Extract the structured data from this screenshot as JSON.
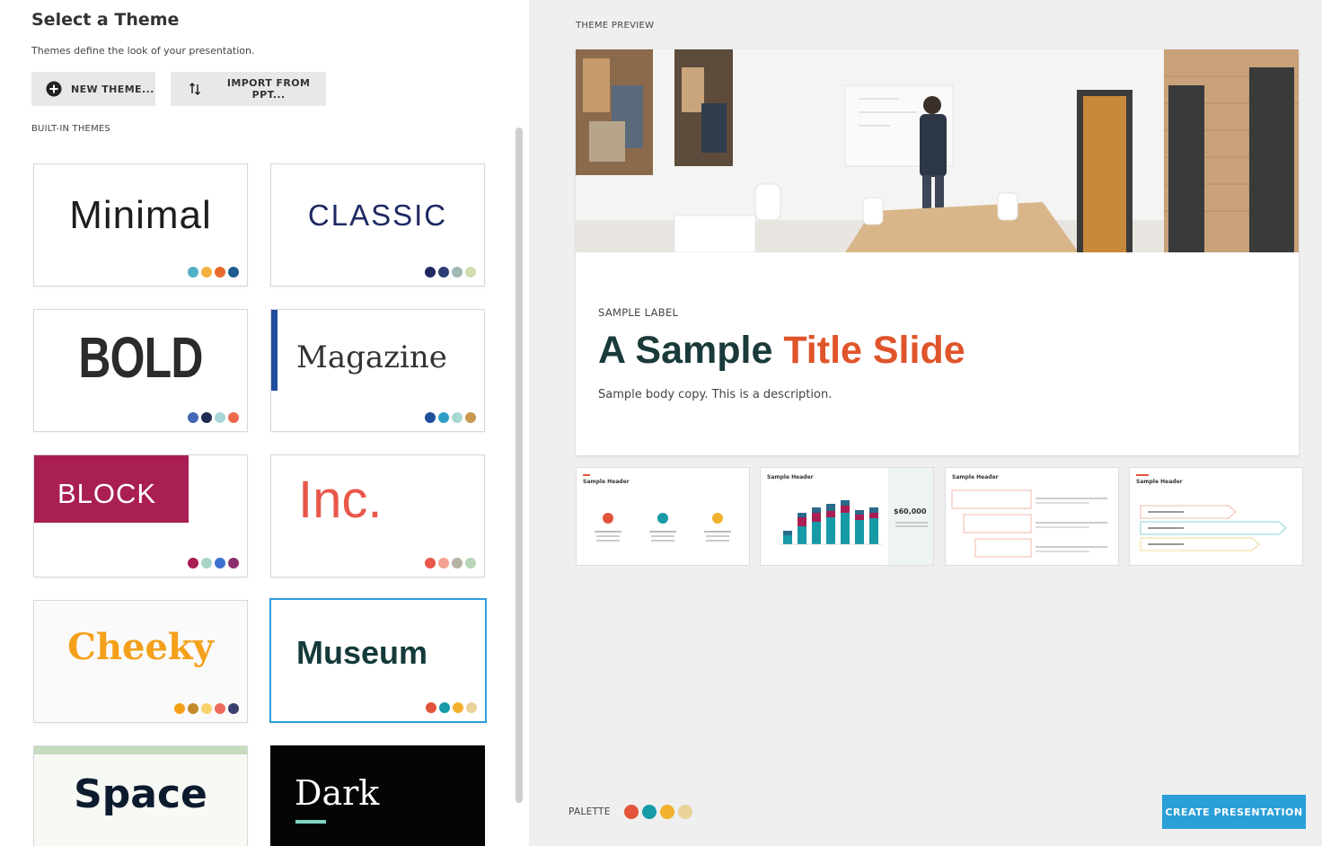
{
  "sidebar": {
    "title": "Select a Theme",
    "subtitle": "Themes define the look of your presentation.",
    "new_theme_label": "NEW THEME...",
    "import_label": "IMPORT FROM PPT...",
    "section_label": "BUILT-IN THEMES",
    "themes": [
      {
        "name": "Minimal",
        "palette": [
          "#4fb0c6",
          "#f4b03e",
          "#e86a2c",
          "#1f5b8f"
        ]
      },
      {
        "name": "CLASSIC",
        "palette": [
          "#1f2a63",
          "#2c3e75",
          "#9fb8b4",
          "#cfdcb0"
        ]
      },
      {
        "name": "BOLD",
        "palette": [
          "#4565b5",
          "#1f2d55",
          "#a8d6d8",
          "#ec6a4c"
        ]
      },
      {
        "name": "Magazine",
        "palette": [
          "#1f4f9c",
          "#2e9ec7",
          "#a9d8d2",
          "#c79a52"
        ]
      },
      {
        "name": "BLOCK",
        "palette": [
          "#a91e53",
          "#a8d5c7",
          "#3d6fcf",
          "#8b2f6b"
        ]
      },
      {
        "name": "Inc.",
        "palette": [
          "#e9574b",
          "#f3a38f",
          "#b7b3a4",
          "#b7d6b8"
        ]
      },
      {
        "name": "Cheeky",
        "palette": [
          "#f5a01a",
          "#c28a2a",
          "#f7d36a",
          "#ee6b5c",
          "#3a3f6e"
        ]
      },
      {
        "name": "Museum",
        "palette": [
          "#e2553a",
          "#169aa6",
          "#f2b12d",
          "#ead39a"
        ]
      },
      {
        "name": "Space",
        "palette": []
      },
      {
        "name": "Dark",
        "palette": []
      }
    ]
  },
  "preview": {
    "label": "THEME PREVIEW",
    "slide_label": "SAMPLE LABEL",
    "title_part1": "A Sample ",
    "title_part2": "Title Slide",
    "body": "Sample body copy. This is a description.",
    "thumbnails": [
      {
        "header": "Sample Header"
      },
      {
        "header": "Sample Header",
        "value": "$60,000"
      },
      {
        "header": "Sample Header"
      },
      {
        "header": "Sample Header"
      }
    ]
  },
  "footer": {
    "palette_label": "PALETTE",
    "palette": [
      "#e2553a",
      "#169aa6",
      "#f2b12d",
      "#ead39a"
    ],
    "create_label": "CREATE PRESENTATION"
  },
  "colors": {
    "accent": "#2a9fd8",
    "title_dark": "#1a3a3a",
    "title_accent": "#e0542a"
  }
}
